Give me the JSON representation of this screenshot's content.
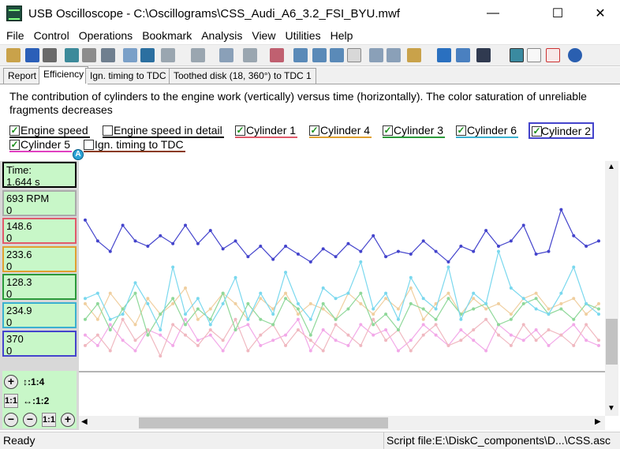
{
  "window": {
    "title": "USB Oscilloscope - C:\\Oscillograms\\CSS_Audi_A6_3.2_FSI_BYU.mwf",
    "minimize": "—",
    "maximize": "☐",
    "close": "✕"
  },
  "menu": [
    "File",
    "Control",
    "Operations",
    "Bookmark",
    "Analysis",
    "View",
    "Utilities",
    "Help"
  ],
  "tabs": [
    "Report",
    "Efficiency",
    "Ign. timing to TDC 1",
    "Toothed disk (18, 360°) to TDC 1"
  ],
  "active_tab": "Efficiency",
  "description": "The contribution of cylinders to the engine work (vertically) versus time (horizontally). The color saturation of unreliable fragments decreases",
  "legend": [
    {
      "label": "Engine speed",
      "checked": true,
      "color": "#000000"
    },
    {
      "label": "Engine speed in detail",
      "checked": false,
      "color": "#000000"
    },
    {
      "label": "Cylinder 1",
      "checked": true,
      "color": "#e05a6a"
    },
    {
      "label": "Cylinder 4",
      "checked": true,
      "color": "#e0a030"
    },
    {
      "label": "Cylinder 3",
      "checked": true,
      "color": "#2a9a3a"
    },
    {
      "label": "Cylinder 6",
      "checked": true,
      "color": "#3ab0d0"
    },
    {
      "label": "Cylinder 2",
      "checked": true,
      "color": "#4444cc"
    },
    {
      "label": "Cylinder 5",
      "checked": true,
      "color": "#e040c0"
    },
    {
      "label": "Ign. timing to TDC",
      "checked": false,
      "color": "#8a3a1a"
    }
  ],
  "marker": "A",
  "values": [
    {
      "l1": "Time:",
      "l2": "1.644 s",
      "color": "#000000"
    },
    {
      "l1": "693 RPM",
      "l2": "0",
      "color": "#888888"
    },
    {
      "l1": "148.6",
      "l2": "0",
      "color": "#e05a6a"
    },
    {
      "l1": "233.6",
      "l2": "0",
      "color": "#e0a030"
    },
    {
      "l1": "128.3",
      "l2": "0",
      "color": "#2a9a3a"
    },
    {
      "l1": "234.9",
      "l2": "0",
      "color": "#3ab0d0"
    },
    {
      "l1": "370",
      "l2": "0",
      "color": "#4444cc"
    }
  ],
  "zoom": {
    "plus": "+",
    "minus": "−",
    "v_ratio": "↕:1:4",
    "h_ratio": "↔:1:2",
    "one_to_one": "1:1"
  },
  "status": {
    "left": "Ready",
    "right": "Script file:E:\\DiskC_components\\D...\\CSS.asc"
  },
  "chart_data": {
    "type": "line",
    "series": [
      {
        "name": "Cylinder 2",
        "color": "#4444cc",
        "values": [
          58,
          50,
          46,
          56,
          50,
          48,
          52,
          49,
          56,
          49,
          54,
          47,
          50,
          44,
          48,
          43,
          48,
          45,
          42,
          47,
          44,
          49,
          46,
          52,
          44,
          46,
          45,
          50,
          46,
          42,
          48,
          46,
          54,
          48,
          50,
          56,
          45,
          46,
          62,
          52,
          48,
          50
        ]
      },
      {
        "name": "Cylinder 6",
        "color": "#7ad8ee",
        "values": [
          28,
          30,
          20,
          22,
          34,
          26,
          16,
          40,
          22,
          28,
          18,
          26,
          36,
          20,
          30,
          22,
          38,
          26,
          20,
          32,
          28,
          30,
          42,
          24,
          30,
          20,
          36,
          28,
          24,
          40,
          20,
          30,
          26,
          46,
          32,
          28,
          24,
          22,
          30,
          40,
          26,
          22
        ]
      },
      {
        "name": "Cylinder 3",
        "color": "#8fd89a",
        "values": [
          20,
          26,
          16,
          24,
          30,
          14,
          22,
          28,
          18,
          24,
          20,
          30,
          16,
          26,
          20,
          18,
          28,
          24,
          14,
          26,
          20,
          24,
          30,
          18,
          22,
          16,
          26,
          24,
          20,
          28,
          22,
          24,
          26,
          18,
          20,
          26,
          28,
          22,
          24,
          20,
          26,
          24
        ]
      },
      {
        "name": "Cylinder 4",
        "color": "#f0cfa0",
        "values": [
          26,
          20,
          30,
          24,
          18,
          28,
          22,
          26,
          32,
          20,
          24,
          30,
          26,
          20,
          28,
          24,
          30,
          22,
          26,
          24,
          20,
          30,
          26,
          22,
          28,
          24,
          32,
          20,
          26,
          30,
          22,
          28,
          24,
          26,
          22,
          28,
          30,
          24,
          26,
          28,
          22,
          26
        ]
      },
      {
        "name": "Cylinder 1",
        "color": "#f0b8c0",
        "values": [
          10,
          14,
          8,
          20,
          12,
          16,
          6,
          18,
          14,
          10,
          16,
          12,
          20,
          8,
          14,
          18,
          10,
          16,
          12,
          8,
          18,
          14,
          10,
          20,
          12,
          16,
          8,
          14,
          18,
          10,
          12,
          16,
          20,
          14,
          10,
          18,
          12,
          16,
          14,
          10,
          18,
          12
        ]
      },
      {
        "name": "Cylinder 5",
        "color": "#f2a8e8",
        "values": [
          14,
          10,
          18,
          12,
          8,
          16,
          14,
          10,
          20,
          12,
          14,
          8,
          16,
          18,
          10,
          12,
          14,
          20,
          8,
          16,
          12,
          10,
          18,
          14,
          16,
          8,
          12,
          18,
          14,
          10,
          16,
          12,
          8,
          18,
          14,
          12,
          16,
          10,
          14,
          18,
          12,
          10
        ]
      }
    ],
    "ylim": [
      0,
      100
    ]
  }
}
